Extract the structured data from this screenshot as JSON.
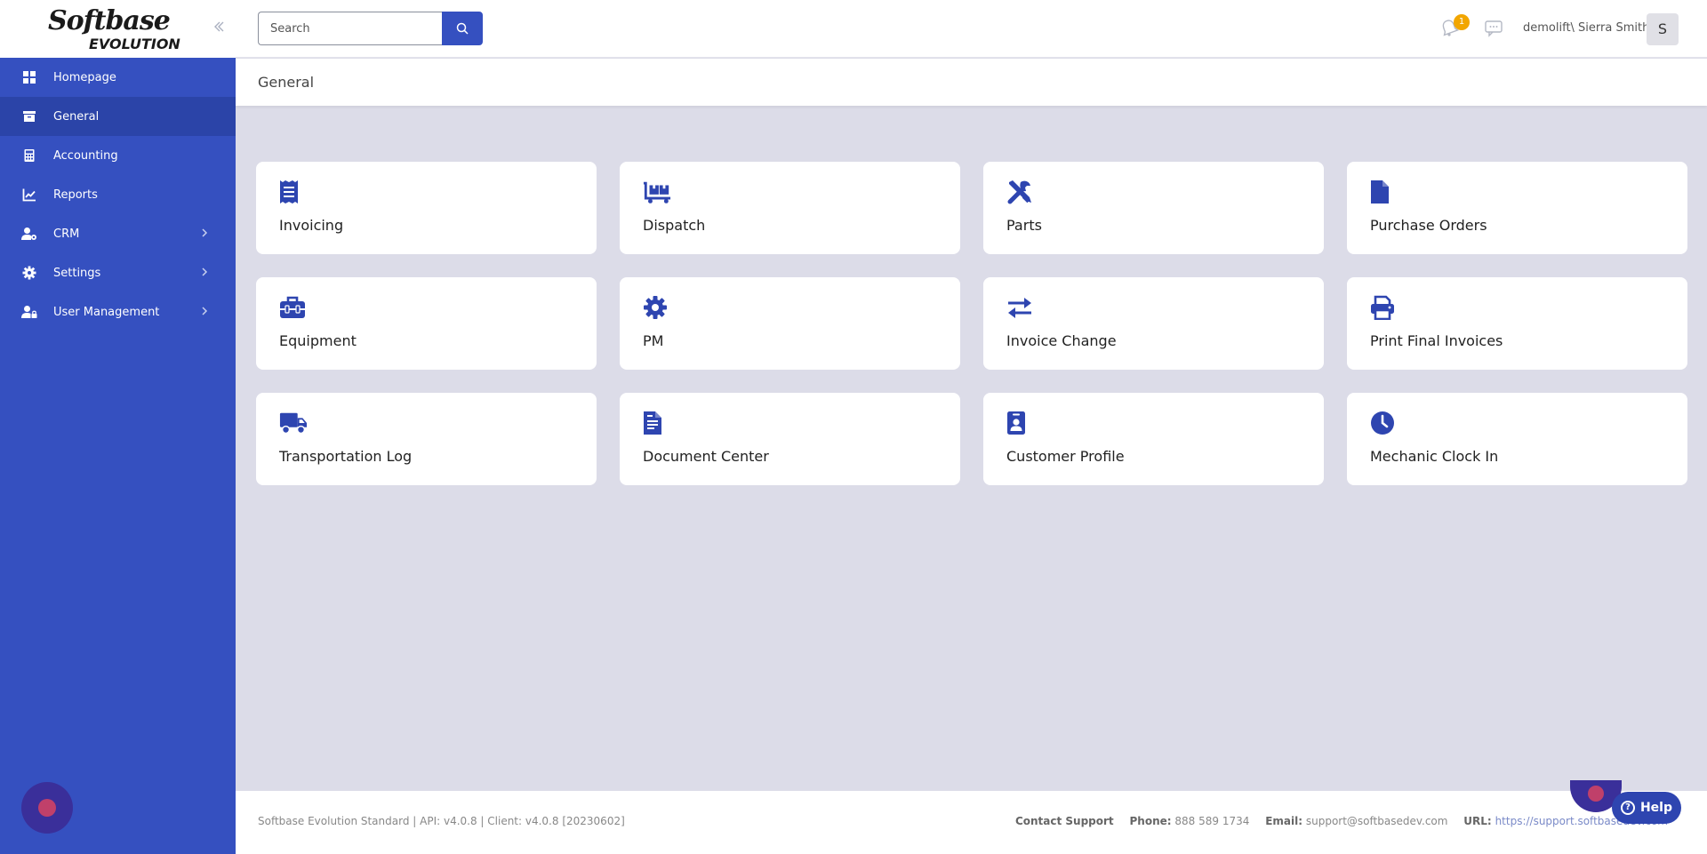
{
  "brand": {
    "logo_top": "Softbase",
    "logo_bottom": "EVOLUTION"
  },
  "sidebar": {
    "items": [
      {
        "label": "Homepage",
        "icon": "dashboard-icon",
        "active": false,
        "expandable": false
      },
      {
        "label": "General",
        "icon": "archive-box-icon",
        "active": true,
        "expandable": false
      },
      {
        "label": "Accounting",
        "icon": "calculator-icon",
        "active": false,
        "expandable": false
      },
      {
        "label": "Reports",
        "icon": "chart-line-icon",
        "active": false,
        "expandable": false
      },
      {
        "label": "CRM",
        "icon": "users-cog-icon",
        "active": false,
        "expandable": true
      },
      {
        "label": "Settings",
        "icon": "gear-icon",
        "active": false,
        "expandable": true
      },
      {
        "label": "User Management",
        "icon": "user-lock-icon",
        "active": false,
        "expandable": true
      }
    ]
  },
  "header": {
    "search_placeholder": "Search",
    "notification_count": "1",
    "user_name": "demolift\\ Sierra Smith",
    "avatar_initial": "S"
  },
  "breadcrumb": {
    "title": "General"
  },
  "cards": [
    {
      "label": "Invoicing",
      "icon": "receipt-icon"
    },
    {
      "label": "Dispatch",
      "icon": "dolly-flatbed-icon"
    },
    {
      "label": "Parts",
      "icon": "tools-icon"
    },
    {
      "label": "Purchase Orders",
      "icon": "file-icon"
    },
    {
      "label": "Equipment",
      "icon": "toolbox-icon"
    },
    {
      "label": "PM",
      "icon": "gear-icon"
    },
    {
      "label": "Invoice Change",
      "icon": "exchange-arrows-icon"
    },
    {
      "label": "Print Final Invoices",
      "icon": "printer-icon"
    },
    {
      "label": "Transportation Log",
      "icon": "truck-icon"
    },
    {
      "label": "Document Center",
      "icon": "document-icon"
    },
    {
      "label": "Customer Profile",
      "icon": "id-badge-icon"
    },
    {
      "label": "Mechanic Clock In",
      "icon": "clock-icon"
    }
  ],
  "footer": {
    "version": "Softbase Evolution Standard | API: v4.0.8 | Client: v4.0.8 [20230602]",
    "contact_label": "Contact Support",
    "phone_label": "Phone:",
    "phone": "888 589 1734",
    "email_label": "Email:",
    "email": "support@softbasedev.com",
    "url_label": "URL:",
    "url": "https://support.softbasedev.com"
  },
  "help": {
    "label": "Help"
  },
  "colors": {
    "primary": "#3550c0",
    "active_nav": "#2b44a8",
    "background": "#dcdce8",
    "badge": "#f2a600"
  }
}
